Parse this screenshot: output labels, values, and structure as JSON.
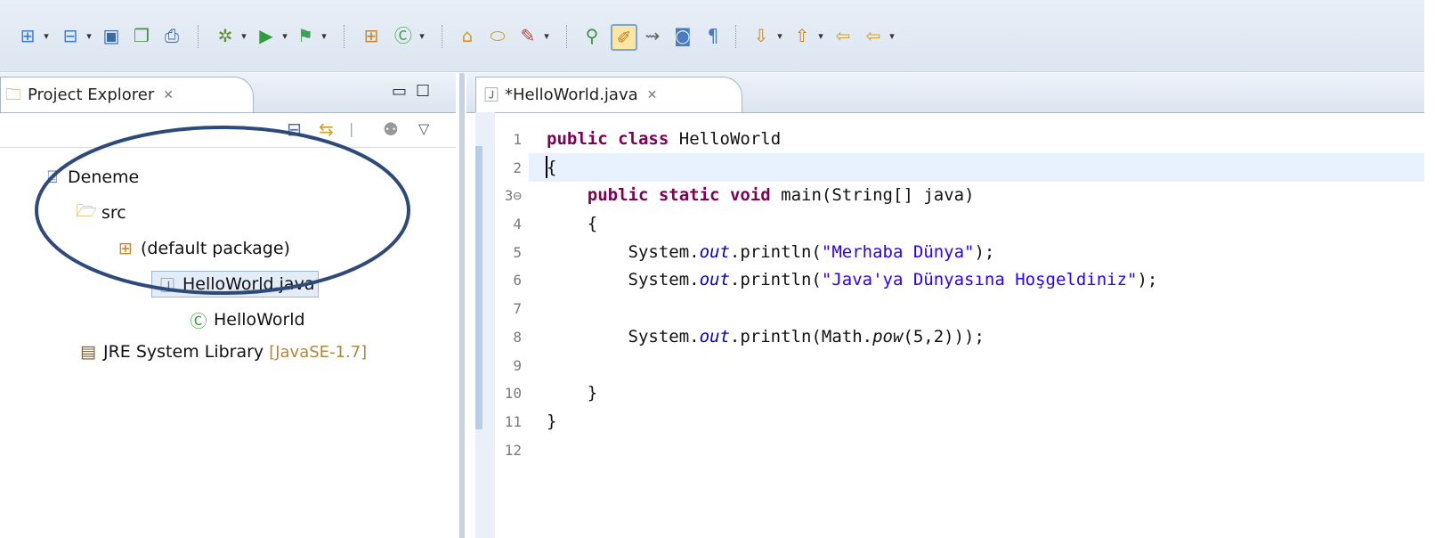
{
  "toolbar": {
    "groups": [
      [
        "new-wizard-icon",
        "new-icon",
        "save-icon",
        "save-all-icon",
        "print-icon"
      ],
      [
        "debug-icon",
        "run-icon",
        "external-tools-icon"
      ],
      [
        "new-java-package-icon",
        "new-java-class-icon"
      ],
      [
        "open-type-icon",
        "open-task-icon",
        "search-icon"
      ],
      [
        "toggle-breadcrumb-icon",
        "mark-occurrences-icon",
        "block-selection-icon",
        "show-whitespace-icon",
        "formatting-marks-icon"
      ],
      [
        "next-annotation-icon",
        "previous-annotation-icon",
        "last-edit-location-icon",
        "back-icon"
      ]
    ]
  },
  "project_explorer": {
    "tab_label": "Project Explorer",
    "tree": [
      {
        "label": "Deneme",
        "icon": "project-folder-icon",
        "depth": 0
      },
      {
        "label": "src",
        "icon": "source-folder-icon",
        "depth": 1
      },
      {
        "label": "(default package)",
        "icon": "package-icon",
        "depth": 2
      },
      {
        "label": "HelloWorld.java",
        "icon": "java-file-icon",
        "depth": 3
      },
      {
        "label": "HelloWorld",
        "icon": "java-class-icon",
        "depth": 4
      },
      {
        "label": "JRE System Library",
        "tag": "[JavaSE-1.7]",
        "icon": "library-icon",
        "depth": 1
      }
    ]
  },
  "editor": {
    "tab_label": "*HelloWorld.java",
    "line_numbers": [
      "1",
      "2",
      "3⊖",
      "4",
      "5",
      "6",
      "7",
      "8",
      "9",
      "10",
      "11",
      "12"
    ],
    "code_lines": [
      "public class HelloWorld",
      "{",
      "    public static void main(String[] java)",
      "    {",
      "        System.out.println(\"Merhaba Dünya\");",
      "        System.out.println(\"Java'ya Dünyasına Hoşgeldiniz\");",
      "",
      "        System.out.println(Math.pow(5,2));",
      "",
      "    }",
      "}",
      ""
    ],
    "tokens": {
      "kw_public": "public",
      "kw_class": "class",
      "kw_static": "static",
      "kw_void": "void",
      "class_name": "HelloWorld",
      "main_sig": "main(String[] java)",
      "system": "System.",
      "out": "out",
      "println": ".println(",
      "str1": "\"Merhaba Dünya\"",
      "str2": "\"Java'ya Dünyasına Hoşgeldiniz\"",
      "math": "Math.",
      "pow": "pow",
      "pow_args": "(5,2)",
      "end": ");",
      "end2": "));",
      "open_brace": "{",
      "close_brace": "}"
    }
  },
  "colors": {
    "keyword": "#7f0055",
    "string": "#2a00ff",
    "field": "#0000c0",
    "ellipse": "#2e4a78"
  }
}
